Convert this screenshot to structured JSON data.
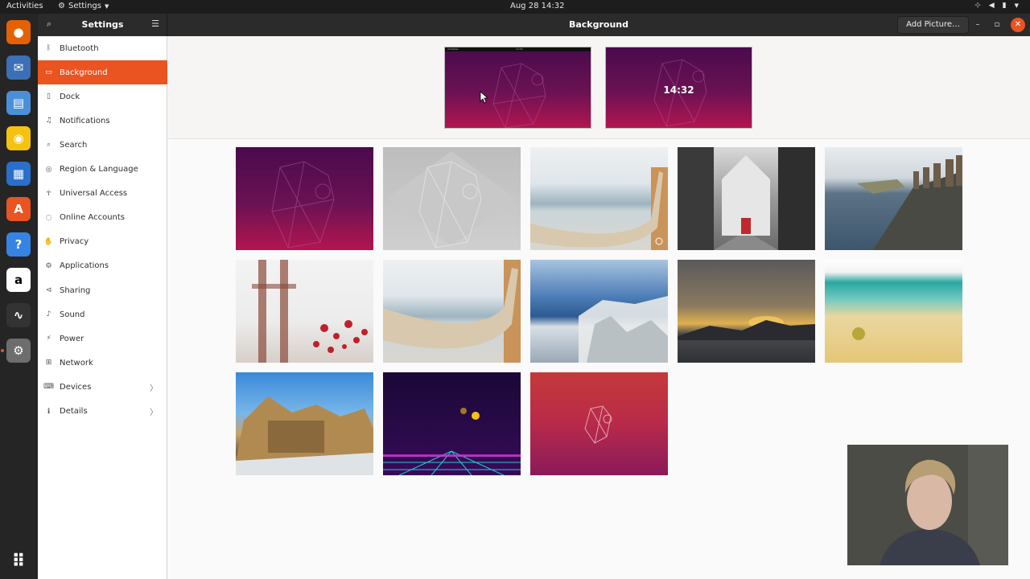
{
  "topbar": {
    "activities": "Activities",
    "app_menu": "Settings",
    "clock": "Aug 28  14:32"
  },
  "dock": {
    "apps": [
      {
        "name": "firefox-icon",
        "color": "#e66000",
        "glyph": "●"
      },
      {
        "name": "thunderbird-icon",
        "color": "#3b6fb6",
        "glyph": "✉"
      },
      {
        "name": "files-icon",
        "color": "#4a90d9",
        "glyph": "▤"
      },
      {
        "name": "rhythmbox-icon",
        "color": "#f5c211",
        "glyph": "◉"
      },
      {
        "name": "writer-icon",
        "color": "#2a6fc9",
        "glyph": "▦"
      },
      {
        "name": "software-icon",
        "color": "#e95420",
        "glyph": "A"
      },
      {
        "name": "help-icon",
        "color": "#3584e4",
        "glyph": "?"
      },
      {
        "name": "amazon-icon",
        "color": "#ffffff",
        "glyph": "a"
      },
      {
        "name": "system-monitor-icon",
        "color": "#333333",
        "glyph": "∿"
      },
      {
        "name": "settings-icon",
        "color": "#6d6d6d",
        "glyph": "⚙"
      }
    ],
    "show_apps_glyph": "⠿"
  },
  "header": {
    "left_title": "Settings",
    "title": "Background",
    "add_picture": "Add Picture…"
  },
  "sidebar": {
    "items": [
      {
        "label": "Bluetooth",
        "icon": "ᛒ"
      },
      {
        "label": "Background",
        "icon": "▭"
      },
      {
        "label": "Dock",
        "icon": "▯"
      },
      {
        "label": "Notifications",
        "icon": "♫"
      },
      {
        "label": "Search",
        "icon": "⌕"
      },
      {
        "label": "Region & Language",
        "icon": "◎"
      },
      {
        "label": "Universal Access",
        "icon": "☥"
      },
      {
        "label": "Online Accounts",
        "icon": "◌"
      },
      {
        "label": "Privacy",
        "icon": "✋"
      },
      {
        "label": "Applications",
        "icon": "⚙"
      },
      {
        "label": "Sharing",
        "icon": "⊲"
      },
      {
        "label": "Sound",
        "icon": "♪"
      },
      {
        "label": "Power",
        "icon": "⚡"
      },
      {
        "label": "Network",
        "icon": "⊞"
      },
      {
        "label": "Devices",
        "icon": "⌨",
        "arrow": "〉"
      },
      {
        "label": "Details",
        "icon": "ℹ",
        "arrow": "〉"
      }
    ]
  },
  "preview": {
    "desktop_bar_left": "Activities",
    "desktop_bar_time": "14:32",
    "lock_time": "14:32"
  }
}
